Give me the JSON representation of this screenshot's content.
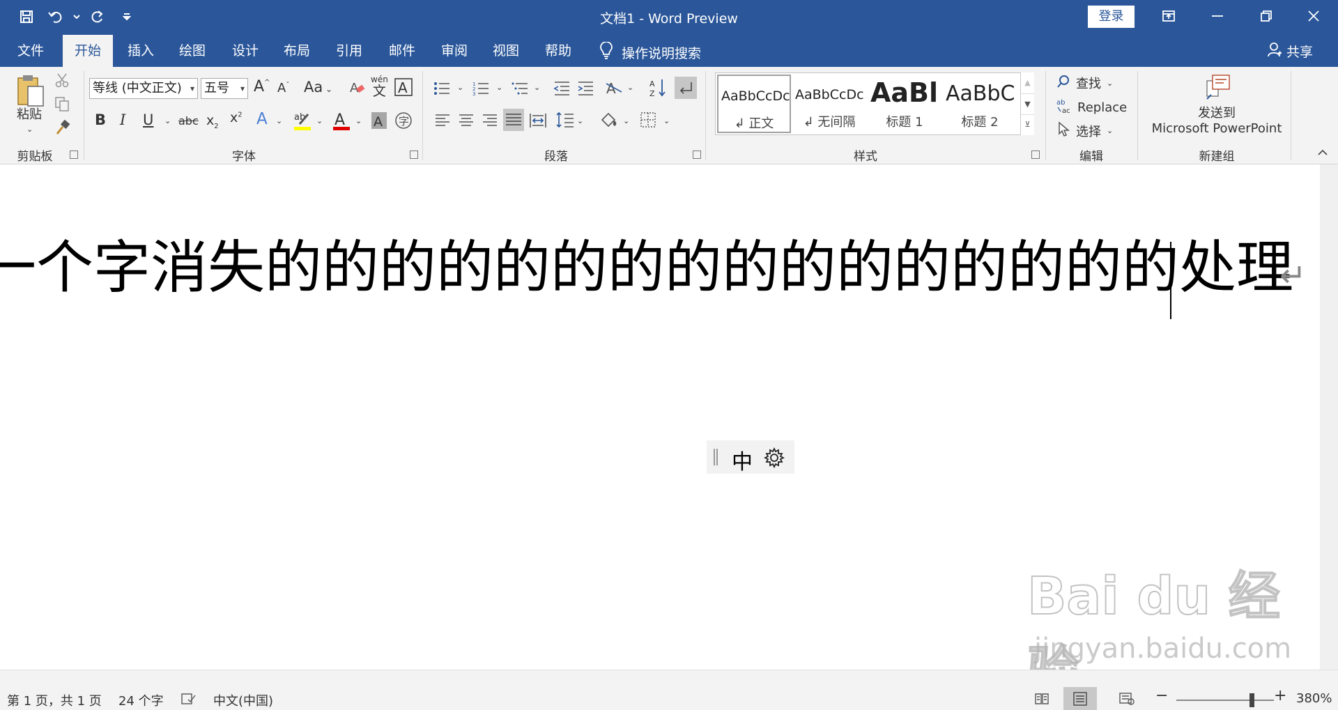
{
  "titlebar": {
    "title": "文档1  -  Word Preview",
    "login_label": "登录",
    "qat_icons": [
      "save-icon",
      "undo-icon",
      "redo-icon",
      "customize-icon"
    ]
  },
  "tabs": [
    {
      "label": "文件"
    },
    {
      "label": "开始"
    },
    {
      "label": "插入"
    },
    {
      "label": "绘图"
    },
    {
      "label": "设计"
    },
    {
      "label": "布局"
    },
    {
      "label": "引用"
    },
    {
      "label": "邮件"
    },
    {
      "label": "审阅"
    },
    {
      "label": "视图"
    },
    {
      "label": "帮助"
    }
  ],
  "active_tab": "开始",
  "tell_me": "操作说明搜索",
  "share_label": "共享",
  "ribbon": {
    "clipboard": {
      "paste_label": "粘贴",
      "group_label": "剪贴板"
    },
    "font": {
      "font_name": "等线 (中文正文)",
      "font_size": "五号",
      "group_label": "字体",
      "phonetic_top": "wén",
      "phonetic_bottom": "文",
      "case_label": "Aa"
    },
    "paragraph": {
      "group_label": "段落"
    },
    "styles": {
      "group_label": "样式",
      "items": [
        {
          "sample": "AaBbCcDc",
          "name": "↲ 正文"
        },
        {
          "sample": "AaBbCcDc",
          "name": "↲ 无间隔"
        },
        {
          "sample": "AaBl",
          "name": "标题 1"
        },
        {
          "sample": "AaBbC",
          "name": "标题 2"
        }
      ]
    },
    "editing": {
      "find_label": "查找",
      "replace_label": "Replace",
      "select_label": "选择",
      "group_label": "编辑"
    },
    "newgroup": {
      "send_line1": "发送到",
      "send_line2": "Microsoft PowerPoint",
      "group_label": "新建组"
    }
  },
  "document": {
    "text": "一个字消失的的的的的的的的的的的的的的的的处理",
    "ime_mode": "中"
  },
  "status": {
    "page": "第 1 页，共 1 页",
    "words": "24 个字",
    "language": "中文(中国)",
    "zoom": "380%",
    "zoom_level": 380
  },
  "watermark": {
    "brand": "Bai du 经验",
    "url": "jingyan.baidu.com"
  }
}
